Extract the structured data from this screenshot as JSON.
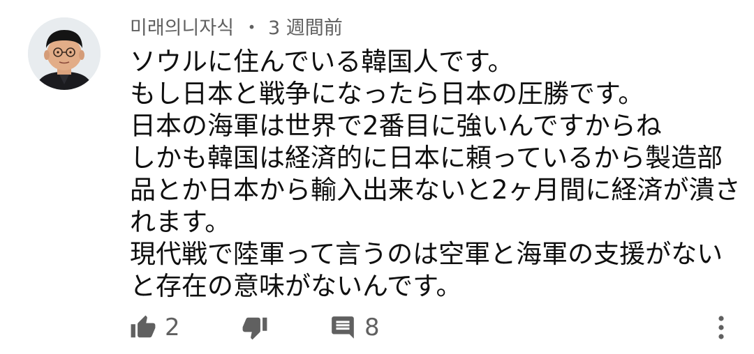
{
  "comment": {
    "author": "미래의니자식",
    "separator": "・",
    "time_ago": "3 週間前",
    "text_lines": [
      "ソウルに住んでいる韓国人です。",
      "もし日本と戦争になったら日本の圧勝です。",
      "日本の海軍は世界で2番目に強いんですからね",
      "しかも韓国は経済的に日本に頼っているから製造部",
      "品とか日本から輸入出来ないと2ヶ月間に経済が潰さ",
      "れます。",
      "現代戦で陸軍って言うのは空軍と海軍の支援がない",
      "と存在の意味がないんです。"
    ],
    "like_count": "2",
    "reply_count": "8"
  },
  "icons": {
    "like": "thumbs-up-icon",
    "dislike": "thumbs-down-icon",
    "reply": "comment-icon",
    "menu": "more-vert-icon"
  },
  "colors": {
    "text": "#0f0f0f",
    "secondary": "#606060",
    "icon": "#606060"
  }
}
